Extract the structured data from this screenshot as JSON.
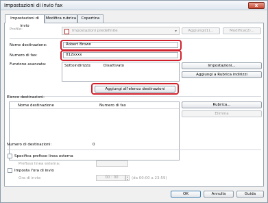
{
  "window": {
    "title": "Impostazioni di invio fax",
    "close_glyph": "x"
  },
  "tabs": [
    {
      "label": "Impostazioni di invio"
    },
    {
      "label": "Modifica rubrica"
    },
    {
      "label": "Copertina"
    }
  ],
  "profile": {
    "label": "Profilo:",
    "value": "Impostazioni predefinite",
    "add_button": "Aggiungi(1)...",
    "edit_button": "Modifica(2)..."
  },
  "recipient": {
    "name_label": "Nome destinazione:",
    "name_value": "Robert Brown",
    "fax_label": "Numero di fax:",
    "fax_value": "012xxxx"
  },
  "functions": {
    "label": "Funzione avanzata:",
    "sub_label": "Sottoindirizzo:",
    "sub_value": "Disattivato",
    "settings_button": "Impostazioni...",
    "add_to_book_button": "Aggiungi a Rubrica indirizzi"
  },
  "add_to_list_button": "Aggiungi all'elenco destinazioni",
  "destination_list": {
    "label": "Elenco destinazioni:",
    "columns": [
      "Nome destinazione",
      "Numero di fax"
    ],
    "rows": [],
    "addressbook_button": "Rubrica...",
    "delete_button": "Elimina"
  },
  "count": {
    "label": "Numero di destinazioni:",
    "value": "0"
  },
  "outside_line": {
    "checkbox_label": "Specifica prefisso linea esterna",
    "prefix_label": "Prefisso linea esterna:",
    "prefix_value": ""
  },
  "send_time": {
    "checkbox_label": "Imposta l'ora di invio",
    "time_label": "Ora di invio:",
    "time_value": "00 : 00",
    "range_hint": "(da 00:00 a 23:59)"
  },
  "footer": {
    "ok": "OK",
    "cancel": "Annulla",
    "help": "Guida"
  }
}
